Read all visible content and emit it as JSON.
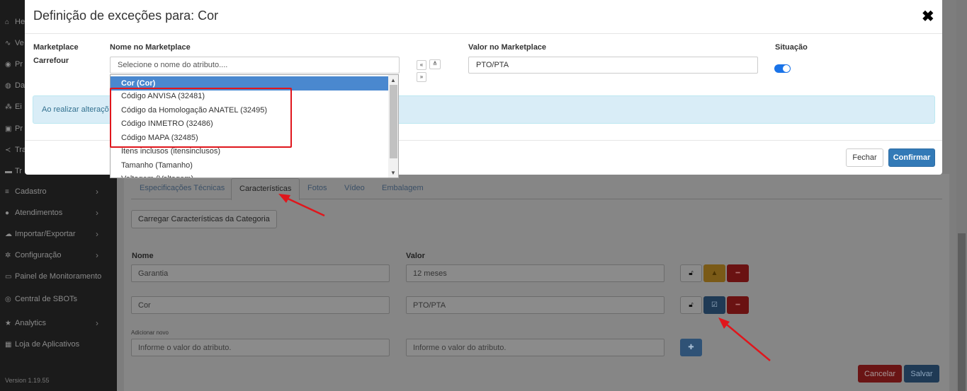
{
  "sidebar": {
    "items": [
      {
        "icon": "home-icon",
        "glyph": "⌂",
        "label": "He",
        "chevron": false
      },
      {
        "icon": "chart-line-icon",
        "glyph": "∿",
        "label": "Ve",
        "chevron": false
      },
      {
        "icon": "box-icon",
        "glyph": "◉",
        "label": "Pr",
        "chevron": false
      },
      {
        "icon": "dashboard-icon",
        "glyph": "◍",
        "label": "Da",
        "chevron": false
      },
      {
        "icon": "sitemap-icon",
        "glyph": "⁂",
        "label": "Ei",
        "chevron": false
      },
      {
        "icon": "window-icon",
        "glyph": "▣",
        "label": "Pr",
        "chevron": false
      },
      {
        "icon": "share-icon",
        "glyph": "≺",
        "label": "Tra",
        "chevron": false
      },
      {
        "icon": "truck-icon",
        "glyph": "▬",
        "label": "Tr",
        "chevron": false
      },
      {
        "icon": "list-icon",
        "glyph": "≡",
        "label": "Cadastro",
        "chevron": true
      },
      {
        "icon": "user-icon",
        "glyph": "●",
        "label": "Atendimentos",
        "chevron": true
      },
      {
        "icon": "cloud-icon",
        "glyph": "☁",
        "label": "Importar/Exportar",
        "chevron": true
      },
      {
        "icon": "gear-icon",
        "glyph": "✲",
        "label": "Configuração",
        "chevron": true
      },
      {
        "icon": "monitor-icon",
        "glyph": "▭",
        "label": "Painel de Monitoramento",
        "chevron": false
      },
      {
        "icon": "robot-icon",
        "glyph": "◎",
        "label": "Central de SBOTs",
        "chevron": false
      },
      {
        "icon": "star-icon",
        "glyph": "★",
        "label": "Analytics",
        "chevron": true
      },
      {
        "icon": "grid-icon",
        "glyph": "▦",
        "label": "Loja de Aplicativos",
        "chevron": false
      }
    ],
    "version": "Version 1.19.55"
  },
  "background": {
    "tabs": [
      "Especificações Técnicas",
      "Características",
      "Fotos",
      "Vídeo",
      "Embalagem"
    ],
    "active_tab": "Características",
    "load_button": "Carregar Características da Categoria",
    "col_nome": "Nome",
    "col_valor": "Valor",
    "rows": [
      {
        "nome": "Garantia",
        "valor": "12 meses"
      },
      {
        "nome": "Cor",
        "valor": "PTO/PTA"
      }
    ],
    "add_new_label": "Adicionar novo",
    "add_nome_placeholder": "Informe o valor do atributo.",
    "add_valor_placeholder": "Informe o valor do atributo.",
    "cancel_label": "Cancelar",
    "save_label": "Salvar"
  },
  "modal": {
    "title": "Definição de exceções para: Cor",
    "close_glyph": "✖",
    "labels": {
      "marketplace": "Marketplace",
      "nome_marketplace": "Nome no Marketplace",
      "valor_marketplace": "Valor no Marketplace",
      "situacao": "Situação"
    },
    "marketplace_value": "Carrefour",
    "nome_placeholder": "Selecione o nome do atributo....",
    "valor_value": "PTO/PTA",
    "situacao_on": true,
    "mini_buttons": [
      "«",
      "≜",
      "»"
    ],
    "alert_text": "Ao realizar alteraçõ",
    "fechar_label": "Fechar",
    "confirmar_label": "Confirmar",
    "dropdown": {
      "options": [
        "Cor (Cor)",
        "Código ANVISA (32481)",
        "Código da Homologação ANATEL (32495)",
        "Código INMETRO (32486)",
        "Código MAPA (32485)",
        "Itens inclusos (itensinclusos)",
        "Tamanho (Tamanho)",
        "Voltagem (Voltagem)"
      ],
      "selected_index": 0,
      "scroll_up": "▲",
      "scroll_down": "▼"
    }
  },
  "colors": {
    "primary": "#337ab7",
    "annotation": "#e0161c",
    "alert_bg": "#d9edf7",
    "selected_option": "#4a88cf"
  }
}
